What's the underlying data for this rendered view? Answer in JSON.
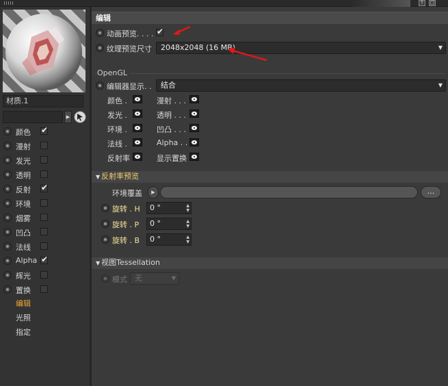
{
  "left_panel": {
    "material_name": "材质.1",
    "channels": [
      {
        "label": "颜色",
        "checked": true
      },
      {
        "label": "漫射",
        "checked": false
      },
      {
        "label": "发光",
        "checked": false
      },
      {
        "label": "透明",
        "checked": false
      },
      {
        "label": "反射",
        "checked": true
      },
      {
        "label": "环境",
        "checked": false
      },
      {
        "label": "烟雾",
        "checked": false
      },
      {
        "label": "凹凸",
        "checked": false
      },
      {
        "label": "法线",
        "checked": false
      },
      {
        "label": "Alpha",
        "checked": true
      },
      {
        "label": "辉光",
        "checked": false
      },
      {
        "label": "置换",
        "checked": false
      }
    ],
    "sub_items": [
      {
        "label": "编辑",
        "active": true
      },
      {
        "label": "光照",
        "active": false
      },
      {
        "label": "指定",
        "active": false
      }
    ]
  },
  "right_panel": {
    "section_title": "编辑",
    "animate_preview": {
      "label": "动画预览. . . .",
      "checked": true
    },
    "texture_preview": {
      "label": "纹理预览尺寸",
      "value": "2048x2048 (16 MB)"
    },
    "opengl": {
      "title": "OpenGL",
      "editor_display": {
        "label": "编辑器显示. .",
        "value": "结合"
      },
      "eye_items_left": [
        "颜色 .",
        "发光 .",
        "环境 .",
        "法线 .",
        "反射率"
      ],
      "eye_items_right": [
        "漫射 . . .",
        "透明 . . .",
        "凹凸 . . .",
        "Alpha . .",
        "显示置换"
      ]
    },
    "reflectance_preview": {
      "title": "反射率预览",
      "env_override_label": "环境覆盖",
      "browse_label": "...",
      "rotations": [
        {
          "label": "旋转 . H",
          "value": "0 °"
        },
        {
          "label": "旋转 . P",
          "value": "0 °"
        },
        {
          "label": "旋转 . B",
          "value": "0 °"
        }
      ]
    },
    "tessellation": {
      "title": "视图Tessellation",
      "mode_label": "模式",
      "mode_value": "无"
    }
  },
  "colors": {
    "accent_orange": "#f0a53a",
    "highlight_yellow": "#f3e29a",
    "annotation_red": "#e01818"
  },
  "icons": [
    "grip-icon",
    "arrow-right-icon",
    "cursor-pick-icon",
    "eye-icon",
    "dropdown-arrow-icon",
    "checkmark-icon",
    "radio-icon"
  ]
}
